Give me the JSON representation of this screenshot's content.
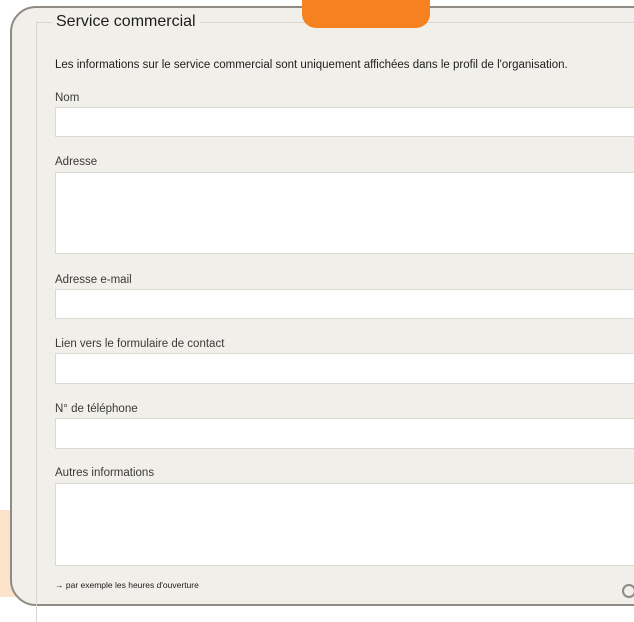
{
  "section": {
    "title": "Service commercial",
    "intro": "Les informations sur le service commercial sont uniquement affichées dans le profil de l'organisation."
  },
  "fields": {
    "nom": {
      "label": "Nom",
      "value": ""
    },
    "adresse": {
      "label": "Adresse",
      "value": ""
    },
    "email": {
      "label": "Adresse e-mail",
      "value": ""
    },
    "contact_form": {
      "label": "Lien vers le formulaire de contact",
      "value": ""
    },
    "phone": {
      "label": "N° de téléphone",
      "value": ""
    },
    "other": {
      "label": "Autres informations",
      "value": ""
    }
  },
  "hint": "→ par exemple les heures d'ouverture",
  "colors": {
    "accent": "#f5821f",
    "card_bg": "#f1efea",
    "peach_bg": "#fbe2c9"
  }
}
